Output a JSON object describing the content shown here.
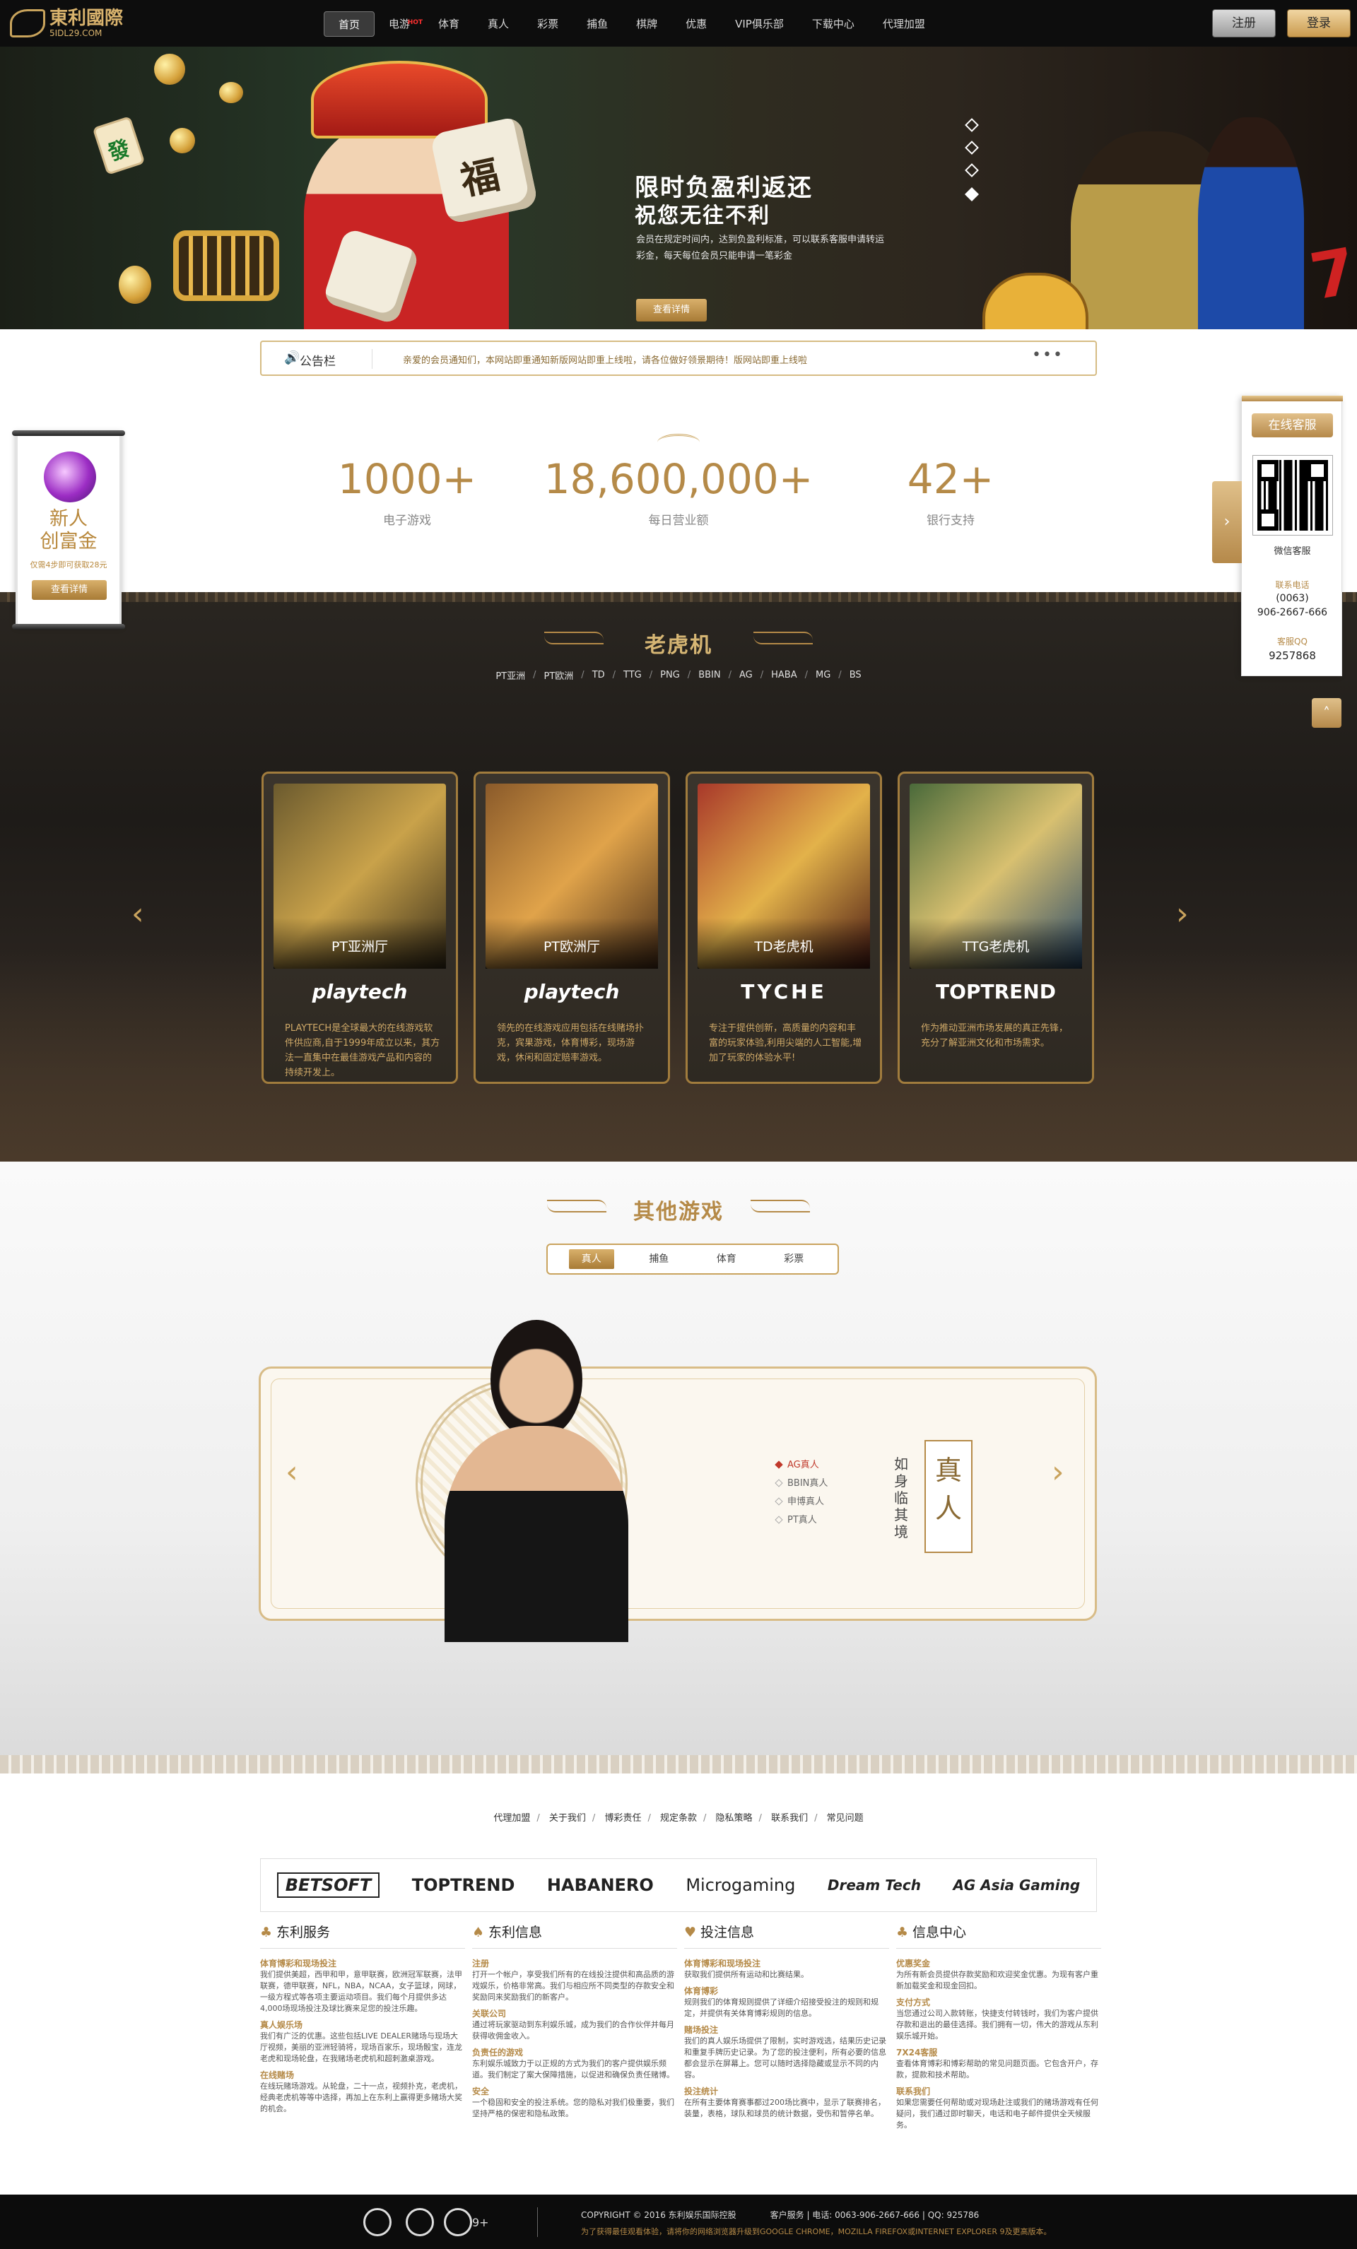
{
  "header": {
    "logo_cn": "東利國際",
    "logo_en": "5IDL29.COM",
    "nav": [
      {
        "label": "首页",
        "active": true
      },
      {
        "label": "电游",
        "hot": "HOT"
      },
      {
        "label": "体育"
      },
      {
        "label": "真人"
      },
      {
        "label": "彩票"
      },
      {
        "label": "捕鱼"
      },
      {
        "label": "棋牌"
      },
      {
        "label": "优惠"
      },
      {
        "label": "VIP俱乐部"
      },
      {
        "label": "下载中心"
      },
      {
        "label": "代理加盟"
      }
    ],
    "register": "注册",
    "login": "登录"
  },
  "banner": {
    "title1": "限时负盈利返还",
    "title2": "祝您无往不利",
    "desc": "会员在规定时间内，达到负盈利标准，可以联系客服申请转运彩金，每天每位会员只能申请一笔彩金",
    "button": "查看详情",
    "dice_char": "福",
    "dice_char2": "發",
    "slide_count": 4,
    "active_slide": 3
  },
  "notice": {
    "label": "公告栏",
    "text": "亲爱的会员通知们，本网站即重通知新版网站即重上线啦，请各位做好领景期待！版网站即重上线啦",
    "more": "•••"
  },
  "stats": [
    {
      "num": "1000+",
      "label": "电子游戏"
    },
    {
      "num": "18,600,000+",
      "label": "每日营业额"
    },
    {
      "num": "42+",
      "label": "银行支持"
    }
  ],
  "left_ad": {
    "line1": "新人",
    "line2": "创富金",
    "sub": "仅需4步即可获取28元",
    "button": "查看详情"
  },
  "right_service": {
    "button": "在线客服",
    "wechat": "微信客服",
    "phone_label": "联系电话",
    "phone1": "(0063)",
    "phone2": "906-2667-666",
    "qq_label": "客服QQ",
    "qq": "9257868"
  },
  "slots": {
    "title": "老虎机",
    "tabs": [
      "PT亚洲",
      "PT欧洲",
      "TD",
      "TTG",
      "PNG",
      "BBIN",
      "AG",
      "HABA",
      "MG",
      "BS"
    ],
    "cards": [
      {
        "name": "PT亚洲厅",
        "brand": "playtech",
        "desc": "PLAYTECH是全球最大的在线游戏软件供应商,自于1999年成立以来，其方法一直集中在最佳游戏产品和内容的持续开发上。",
        "color": "#6b5a2e"
      },
      {
        "name": "PT欧洲厅",
        "brand": "playtech",
        "desc": "领先的在线游戏应用包括在线赌场扑克，宾果游戏，体育博彩，现场游戏，休闲和固定赔率游戏。",
        "color": "#8a5a2a"
      },
      {
        "name": "TD老虎机",
        "brand": "TYCHE",
        "desc": "专注于提供创新，高质量的内容和丰富的玩家体验,利用尖端的人工智能,增加了玩家的体验水平!",
        "color": "#a8382a"
      },
      {
        "name": "TTG老虎机",
        "brand": "TOPTREND",
        "desc": "作为推动亚洲市场发展的真正先锋，充分了解亚洲文化和市场需求。",
        "color": "#4a6a3a"
      }
    ]
  },
  "other": {
    "title": "其他游戏",
    "tabs": [
      {
        "label": "真人",
        "on": true
      },
      {
        "label": "捕鱼"
      },
      {
        "label": "体育"
      },
      {
        "label": "彩票"
      }
    ],
    "live": [
      {
        "label": "AG真人",
        "on": true
      },
      {
        "label": "BBIN真人"
      },
      {
        "label": "申博真人"
      },
      {
        "label": "PT真人"
      }
    ],
    "big": "真人",
    "side": "如身临其境"
  },
  "footer": {
    "links": [
      "代理加盟",
      "关于我们",
      "博彩责任",
      "规定条款",
      "隐私策略",
      "联系我们",
      "常见问题"
    ],
    "partners": [
      "BETSOFT",
      "TOPTREND",
      "HABANERO",
      "Microgaming",
      "Dream Tech",
      "AG Asia Gaming"
    ],
    "cols": [
      {
        "title": "东利服务",
        "icon": "♣",
        "items": [
          {
            "h": "体育博彩和现场投注",
            "t": "我们提供美超，西甲和甲，意甲联赛，欧洲冠军联赛，法甲联赛，德甲联赛，NFL，NBA，NCAA，女子篮球，网球，一级方程式等各项主要运动项目。我们每个月提供多达4,000场现场投注及球比赛来足您的投注乐趣。"
          },
          {
            "h": "真人娱乐场",
            "t": "我们有广泛的优惠。这些包括LIVE DEALER赌场与现场大厅视频，美丽的亚洲轻骑将，现场百家乐，现场骰宝，连龙老虎和现场轮盘，在我赌场老虎机和超刺激桌游戏。"
          },
          {
            "h": "在线赌场",
            "t": "在线玩赌场游戏。从轮盘，二十一点，视频扑克，老虎机，经典老虎机等等中选择，再加上在东利上赢得更多赌场大奖的机会。"
          }
        ]
      },
      {
        "title": "东利信息",
        "icon": "♠",
        "items": [
          {
            "h": "注册",
            "t": "打开一个帐户，享受我们所有的在线投注提供和高品质的游戏娱乐，价格非常高。我们与相应所不同类型的存款安全和奖励同来奖励我们的新客户。"
          },
          {
            "h": "关联公司",
            "t": "通过将玩家驱动到东利娱乐城，成为我们的合作伙伴并每月获得收佣金收入。"
          },
          {
            "h": "负责任的游戏",
            "t": "东利娱乐城致力于以正规的方式为我们的客户提供娱乐频道。我们制定了案大保障措施，以促进和确保负责任赌博。"
          },
          {
            "h": "安全",
            "t": "一个稳固和安全的投注系统。您的隐私对我们极重要，我们坚持严格的保密和隐私政策。"
          }
        ]
      },
      {
        "title": "投注信息",
        "icon": "♥",
        "items": [
          {
            "h": "体育博彩和现场投注",
            "t": "获取我们提供所有运动和比赛结果。"
          },
          {
            "h": "体育博彩",
            "t": "规则我们的体育规则提供了详细介绍接受投注的规则和规定，并提供有关体育博彩规则的信息。"
          },
          {
            "h": "赌场投注",
            "t": "我们的真人娱乐场提供了限制，实时游戏选，结果历史记录和重复手牌历史记录。为了您的投注便利，所有必要的信息都会显示在屏幕上。您可以随时选择隐藏或显示不同的内容。"
          },
          {
            "h": "投注统计",
            "t": "在所有主要体育赛事都过200场比赛中，显示了联赛排名，装量，表格，球队和球员的统计数据，受伤和暂停名单。"
          }
        ]
      },
      {
        "title": "信息中心",
        "icon": "♣",
        "items": [
          {
            "h": "优惠奖金",
            "t": "为所有新会员提供存款奖励和欢迎奖金优惠。为现有客户重新加载奖金和现金回扣。"
          },
          {
            "h": "支付方式",
            "t": "当您通过公司入款转账，快捷支付转钱时，我们为客户提供存款和退出的最佳选择。我们拥有一切，伟大的游戏从东利娱乐城开始。"
          },
          {
            "h": "7X24客服",
            "t": "查看体育博彩和博彩帮助的常见问题页面。它包含开户，存款，提款和技术帮助。"
          },
          {
            "h": "联系我们",
            "t": "如果您需要任何帮助或对现场赴注或我们的赌场游戏有任何疑问，我们通过即时聊天，电话和电子邮件提供全天候服务。"
          }
        ]
      }
    ],
    "ie9": "9+",
    "copyright": "COPYRIGHT © 2016 东利娱乐国际控股　　　　客户服务 | 电话: 0063-906-2667-666 | QQ: 925786",
    "warning": "为了获得最佳观看体验，请将你的网络浏览器升级到GOOGLE CHROME，MOZILLA FIREFOX或INTERNET EXPLORER 9及更高版本。"
  },
  "colors": {
    "gold": "#b58a48",
    "dark": "#0d0d0d"
  }
}
